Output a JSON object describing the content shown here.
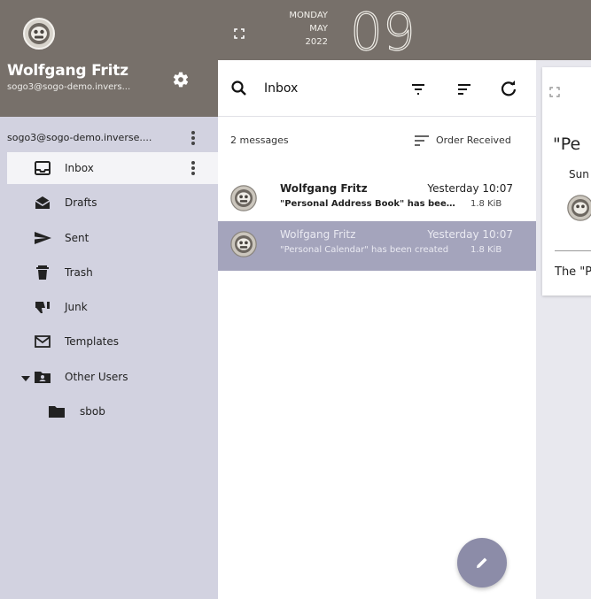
{
  "account": {
    "user_name": "Wolfgang Fritz",
    "email_short": "sogo3@sogo-demo.invers...",
    "mailbox_label": "sogo3@sogo-demo.inverse...."
  },
  "folders": [
    {
      "label": "Inbox",
      "icon": "inbox-icon",
      "active": true
    },
    {
      "label": "Drafts",
      "icon": "drafts-icon"
    },
    {
      "label": "Sent",
      "icon": "send-icon"
    },
    {
      "label": "Trash",
      "icon": "trash-icon"
    },
    {
      "label": "Junk",
      "icon": "thumb-down-icon"
    },
    {
      "label": "Templates",
      "icon": "mail-outline-icon"
    },
    {
      "label": "Other Users",
      "icon": "shared-folder-icon",
      "expanded": true
    },
    {
      "label": "sbob",
      "icon": "folder-icon"
    }
  ],
  "date": {
    "weekday": "MONDAY",
    "month": "MAY",
    "year": "2022",
    "day": "09"
  },
  "list": {
    "title": "Inbox",
    "count_label": "2 messages",
    "sort_label": "Order Received",
    "messages": [
      {
        "from": "Wolfgang Fritz",
        "time": "Yesterday 10:07",
        "subject": "\"Personal Address Book\" has been created",
        "size": "1.8 KiB",
        "selected": false
      },
      {
        "from": "Wolfgang Fritz",
        "time": "Yesterday 10:07",
        "subject": "\"Personal Calendar\" has been created",
        "size": "1.8 KiB",
        "selected": true
      }
    ]
  },
  "reader": {
    "subject_partial": "\"Pe",
    "date_partial": "Sun",
    "body_partial": "The \"P"
  },
  "colors": {
    "header_bg": "#77706a",
    "sidebar_bg": "#d2d2e0",
    "selected_row": "#a4a4bc",
    "fab": "#8c8ca8"
  }
}
